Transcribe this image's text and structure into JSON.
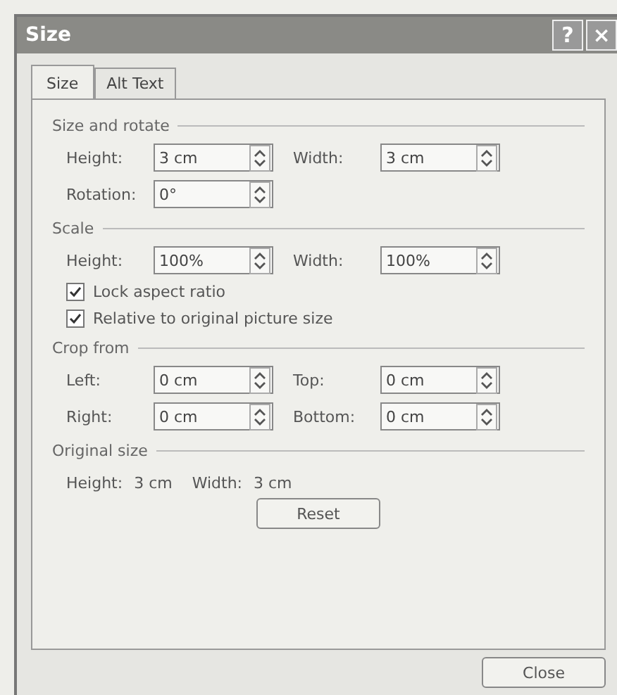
{
  "window": {
    "title": "Size",
    "help": "?",
    "close": "×"
  },
  "tabs": [
    {
      "label": "Size",
      "selected": true
    },
    {
      "label": "Alt Text",
      "selected": false
    }
  ],
  "sections": [
    {
      "title": "Size and rotate",
      "rows": [
        {
          "kind": "fields",
          "items": [
            {
              "label": "Height:",
              "value": "3 cm"
            },
            {
              "label": "Width:",
              "value": "3 cm"
            }
          ]
        },
        {
          "kind": "fields",
          "items": [
            {
              "label": "Rotation:",
              "value": "0°"
            }
          ]
        }
      ]
    },
    {
      "title": "Scale",
      "rows": [
        {
          "kind": "fields",
          "items": [
            {
              "label": "Height:",
              "value": "100%"
            },
            {
              "label": "Width:",
              "value": "100%"
            }
          ]
        },
        {
          "kind": "checkbox",
          "label": "Lock aspect ratio",
          "checked": true
        },
        {
          "kind": "checkbox",
          "label": "Relative to original picture size",
          "checked": true
        }
      ]
    },
    {
      "title": "Crop from",
      "rows": [
        {
          "kind": "fields",
          "items": [
            {
              "label": "Left:",
              "value": "0 cm"
            },
            {
              "label": "Top:",
              "value": "0 cm"
            }
          ]
        },
        {
          "kind": "fields",
          "items": [
            {
              "label": "Right:",
              "value": "0 cm"
            },
            {
              "label": "Bottom:",
              "value": "0 cm"
            }
          ]
        }
      ]
    },
    {
      "title": "Original size",
      "rows": [
        {
          "kind": "info",
          "items": [
            "Height:",
            "3 cm",
            "Width:",
            "3 cm"
          ]
        },
        {
          "kind": "button",
          "label": "Reset"
        }
      ]
    }
  ],
  "buttons": [
    "Close"
  ]
}
